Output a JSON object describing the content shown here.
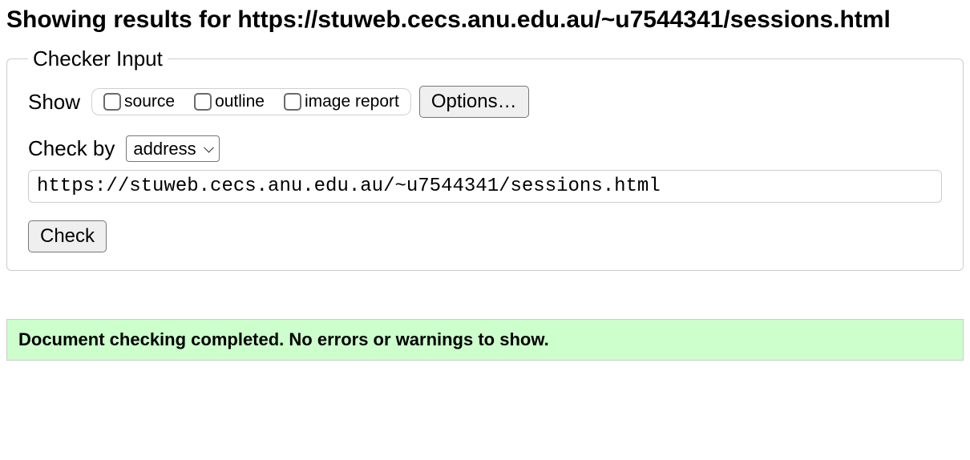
{
  "heading": "Showing results for https://stuweb.cecs.anu.edu.au/~u7544341/sessions.html",
  "checker": {
    "legend": "Checker Input",
    "show_label": "Show",
    "source_label": "source",
    "outline_label": "outline",
    "image_report_label": "image report",
    "options_button": "Options…",
    "check_by_label": "Check by",
    "check_by_value": "address",
    "url_value": "https://stuweb.cecs.anu.edu.au/~u7544341/sessions.html",
    "check_button": "Check"
  },
  "result": {
    "message": "Document checking completed. No errors or warnings to show."
  }
}
